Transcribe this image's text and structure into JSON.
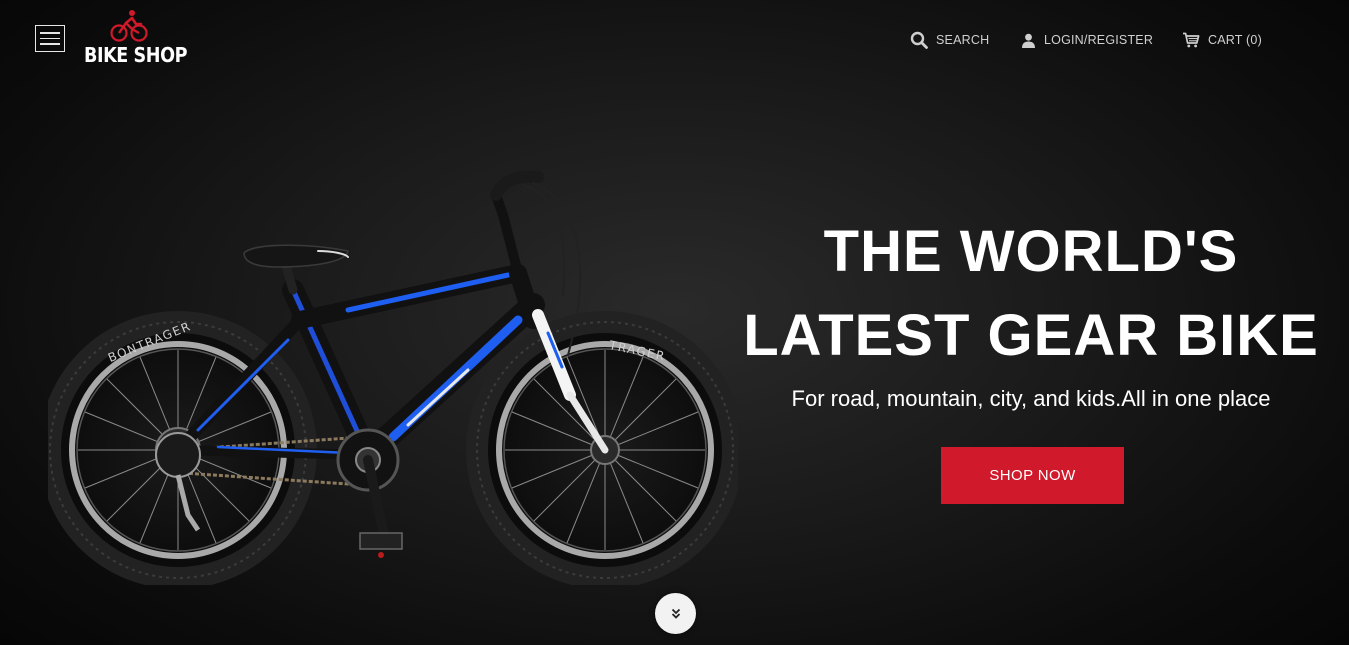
{
  "header": {
    "logo_text": "BIKE SHOP",
    "nav": {
      "search_label": "SEARCH",
      "login_label": "LOGIN/REGISTER",
      "cart_label": "CART (0)"
    }
  },
  "hero": {
    "headline_line1": "THE WORLD'S",
    "headline_line2": "LATEST GEAR BIKE",
    "subline": "For road, mountain, city, and kids.All in one place",
    "cta_label": "SHOP NOW"
  },
  "icons": {
    "menu": "hamburger-icon",
    "logo": "cyclist-icon",
    "search": "search-icon",
    "login": "user-icon",
    "cart": "cart-icon",
    "scroll": "chevron-double-down-icon"
  },
  "colors": {
    "accent": "#d0192a",
    "background": "#111111",
    "text": "#ffffff"
  }
}
